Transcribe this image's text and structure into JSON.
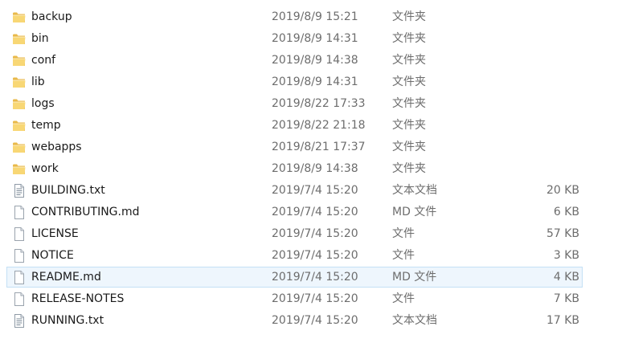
{
  "files": [
    {
      "name": "backup",
      "date": "2019/8/9 15:21",
      "type": "文件夹",
      "size": "",
      "icon": "folder-icon"
    },
    {
      "name": "bin",
      "date": "2019/8/9 14:31",
      "type": "文件夹",
      "size": "",
      "icon": "folder-icon"
    },
    {
      "name": "conf",
      "date": "2019/8/9 14:38",
      "type": "文件夹",
      "size": "",
      "icon": "folder-icon"
    },
    {
      "name": "lib",
      "date": "2019/8/9 14:31",
      "type": "文件夹",
      "size": "",
      "icon": "folder-icon"
    },
    {
      "name": "logs",
      "date": "2019/8/22 17:33",
      "type": "文件夹",
      "size": "",
      "icon": "folder-icon"
    },
    {
      "name": "temp",
      "date": "2019/8/22 21:18",
      "type": "文件夹",
      "size": "",
      "icon": "folder-icon"
    },
    {
      "name": "webapps",
      "date": "2019/8/21 17:37",
      "type": "文件夹",
      "size": "",
      "icon": "folder-icon"
    },
    {
      "name": "work",
      "date": "2019/8/9 14:38",
      "type": "文件夹",
      "size": "",
      "icon": "folder-icon"
    },
    {
      "name": "BUILDING.txt",
      "date": "2019/7/4 15:20",
      "type": "文本文档",
      "size": "20 KB",
      "icon": "text-file-icon"
    },
    {
      "name": "CONTRIBUTING.md",
      "date": "2019/7/4 15:20",
      "type": "MD 文件",
      "size": "6 KB",
      "icon": "file-icon"
    },
    {
      "name": "LICENSE",
      "date": "2019/7/4 15:20",
      "type": "文件",
      "size": "57 KB",
      "icon": "file-icon"
    },
    {
      "name": "NOTICE",
      "date": "2019/7/4 15:20",
      "type": "文件",
      "size": "3 KB",
      "icon": "file-icon"
    },
    {
      "name": "README.md",
      "date": "2019/7/4 15:20",
      "type": "MD 文件",
      "size": "4 KB",
      "icon": "file-icon"
    },
    {
      "name": "RELEASE-NOTES",
      "date": "2019/7/4 15:20",
      "type": "文件",
      "size": "7 KB",
      "icon": "file-icon"
    },
    {
      "name": "RUNNING.txt",
      "date": "2019/7/4 15:20",
      "type": "文本文档",
      "size": "17 KB",
      "icon": "text-file-icon"
    }
  ],
  "hovered_row": "README.md",
  "colors": {
    "folder_body": "#e9b949",
    "folder_front": "#f8d775",
    "hover_border": "#c4e0f5",
    "hover_fill": "#eef6fd",
    "secondary_text": "#6d6d6d"
  }
}
